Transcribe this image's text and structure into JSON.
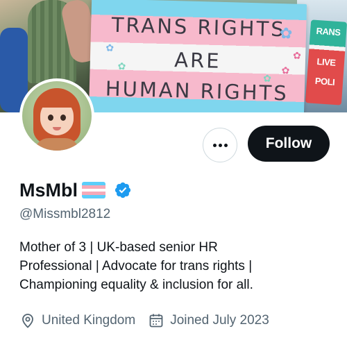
{
  "banner": {
    "sign_lines": [
      "TRANS RIGHTS",
      "ARE",
      "HUMAN RIGHTS"
    ],
    "side_sign_text": [
      "RANS",
      "LIVE",
      "POLI"
    ],
    "colors": {
      "trans_blue": "#7fd6ee",
      "trans_pink": "#f7b9cc",
      "trans_white": "#f5f5f5"
    }
  },
  "profile": {
    "display_name": "MsMbl",
    "handle": "@Missmbl2812",
    "verified": true,
    "bio_lines": [
      "Mother of 3 | UK-based senior HR",
      "Professional | Advocate for trans rights |",
      "Championing equality & inclusion for all."
    ],
    "location": "United Kingdom",
    "joined": "Joined July 2023"
  },
  "actions": {
    "follow_label": "Follow",
    "more_icon": "more-dots-icon"
  },
  "colors": {
    "text": "#0f1419",
    "muted": "#536471",
    "verified_blue": "#1d9bf0",
    "follow_bg": "#0f1419"
  }
}
